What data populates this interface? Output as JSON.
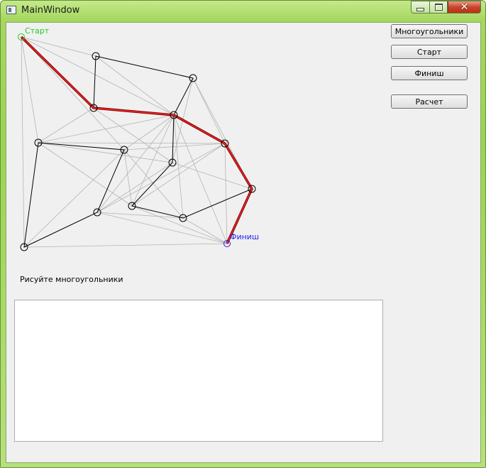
{
  "window": {
    "title": "MainWindow"
  },
  "buttons": {
    "polygons": "Многоугольники",
    "start": "Старт",
    "finish": "Финиш",
    "calculate": "Расчет"
  },
  "canvas": {
    "start_label": "Старт",
    "finish_label": "Финиш",
    "colors": {
      "path": "#d42020",
      "path_dark": "#8b0000",
      "edge": "#000000",
      "visibility": "#b4b4b4",
      "start": "#22cc22",
      "finish": "#2222ee"
    }
  },
  "status_text": "Рисуйте многоугольники",
  "output_text": ""
}
